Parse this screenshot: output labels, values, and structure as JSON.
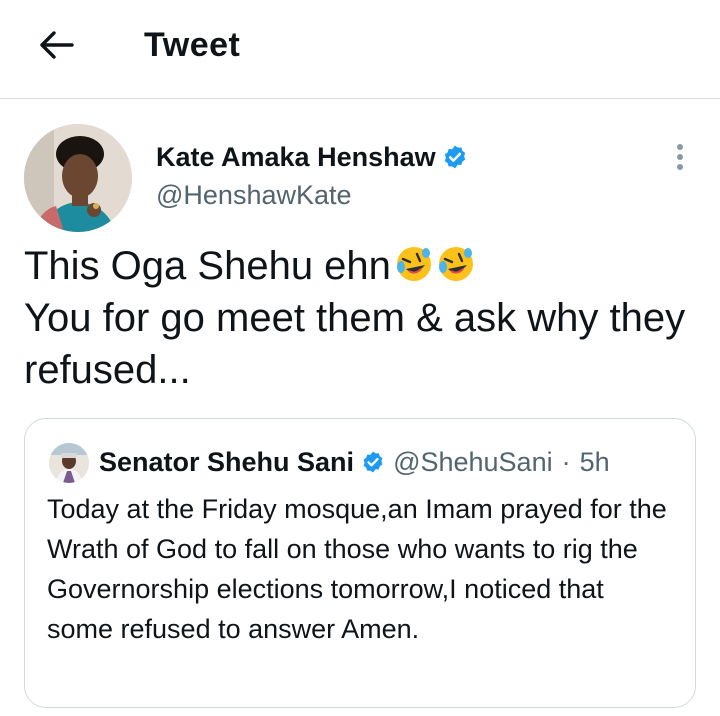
{
  "header": {
    "title": "Tweet",
    "back_icon": "arrow-left-icon"
  },
  "tweet": {
    "author": {
      "name": "Kate Amaka Henshaw",
      "handle": "@HenshawKate",
      "verified": true
    },
    "text": "This Oga Shehu ehn\nYou for go meet them & ask why they refused...",
    "emojis": [
      "rolling-on-floor-laughing",
      "rolling-on-floor-laughing"
    ],
    "more_icon": "more-vertical-icon"
  },
  "quoted_tweet": {
    "author": {
      "name": "Senator Shehu Sani",
      "handle": "@ShehuSani",
      "verified": true
    },
    "separator": "·",
    "time": "5h",
    "text": "Today at the Friday mosque,an Imam prayed for the Wrath of God to fall on those who wants to rig the Governorship elections tomorrow,I noticed that some refused to answer Amen."
  },
  "colors": {
    "text_primary": "#0f1419",
    "text_secondary": "#536471",
    "verified_badge": "#1d9bf0",
    "border": "#cfd9de"
  }
}
